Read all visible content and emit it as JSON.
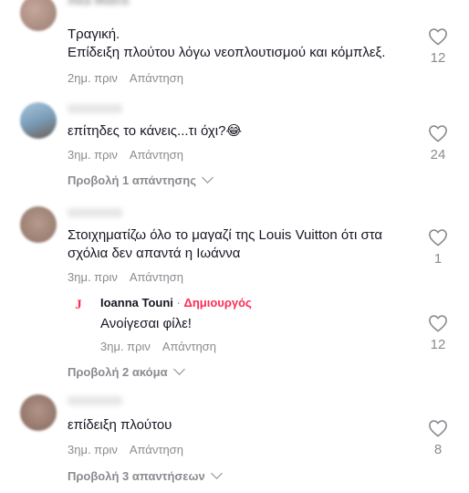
{
  "comments": [
    {
      "username": "Aka Matra",
      "text": "Τραγική.\nΕπίδειξη πλούτου λόγω νεοπλουτισμού και κόμπλεξ.",
      "time": "2ημ. πριν",
      "reply_label": "Απάντηση",
      "likes": "12",
      "view_replies": ""
    },
    {
      "username": "",
      "text": "επίτηδες το κάνεις...τι όχι?😂",
      "time": "3ημ. πριν",
      "reply_label": "Απάντηση",
      "likes": "24",
      "view_replies": "Προβολή 1 απάντησης"
    },
    {
      "username": "",
      "text": "Στοιχηματίζω όλο το μαγαζί της Louis Vuitton ότι στα σχόλια δεν απαντά η Ιωάννα",
      "time": "3ημ. πριν",
      "reply_label": "Απάντηση",
      "likes": "1",
      "view_replies": "Προβολή 2 ακόμα",
      "reply": {
        "avatar_letter": "J",
        "username": "Ioanna Touni",
        "separator": " · ",
        "badge": "Δημιουργός",
        "text": "Ανοίγεσαι φίλε!",
        "time": "3ημ. πριν",
        "reply_label": "Απάντηση",
        "likes": "12"
      }
    },
    {
      "username": "",
      "text": "επίδειξη πλούτου",
      "time": "3ημ. πριν",
      "reply_label": "Απάντηση",
      "likes": "8",
      "view_replies": "Προβολή 3 απαντήσεων"
    }
  ],
  "colors": {
    "text": "#161823",
    "secondary": "#8a8b91",
    "creator_badge": "#fe2c55",
    "reply_avatar_letter": "#fe2c55"
  }
}
